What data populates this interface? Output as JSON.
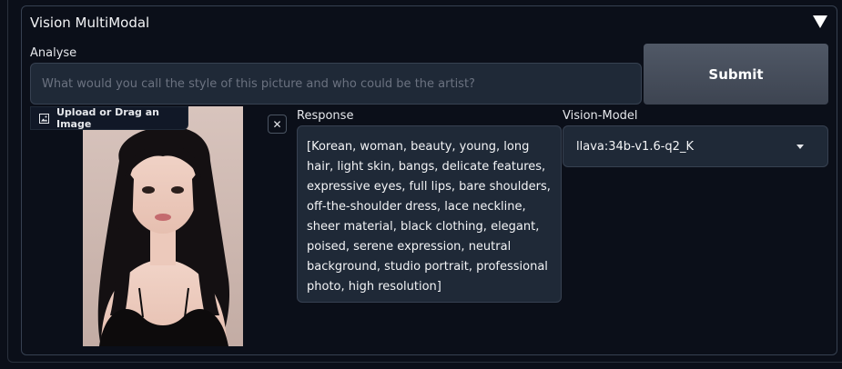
{
  "panel": {
    "title": "Vision MultiModal"
  },
  "prompt": {
    "label": "Analyse",
    "placeholder": "What would you call the style of this picture and who could be the artist?"
  },
  "submit_label": "Submit",
  "image_input": {
    "upload_label": "Upload or Drag an Image",
    "icon": "image-icon"
  },
  "response": {
    "label": "Response",
    "text": "[Korean, woman, beauty, young, long hair, light skin, bangs, delicate features, expressive eyes, full lips, bare shoulders, off-the-shoulder dress, lace neckline, sheer material, black clothing, elegant, poised, serene expression, neutral background, studio portrait, professional photo, high resolution]"
  },
  "model": {
    "label": "Vision-Model",
    "selected": "llava:34b-v1.6-q2_K"
  },
  "colors": {
    "background": "#0b0f19",
    "input_bg": "#1f2937",
    "border": "#374151",
    "button": "#4a515e"
  }
}
